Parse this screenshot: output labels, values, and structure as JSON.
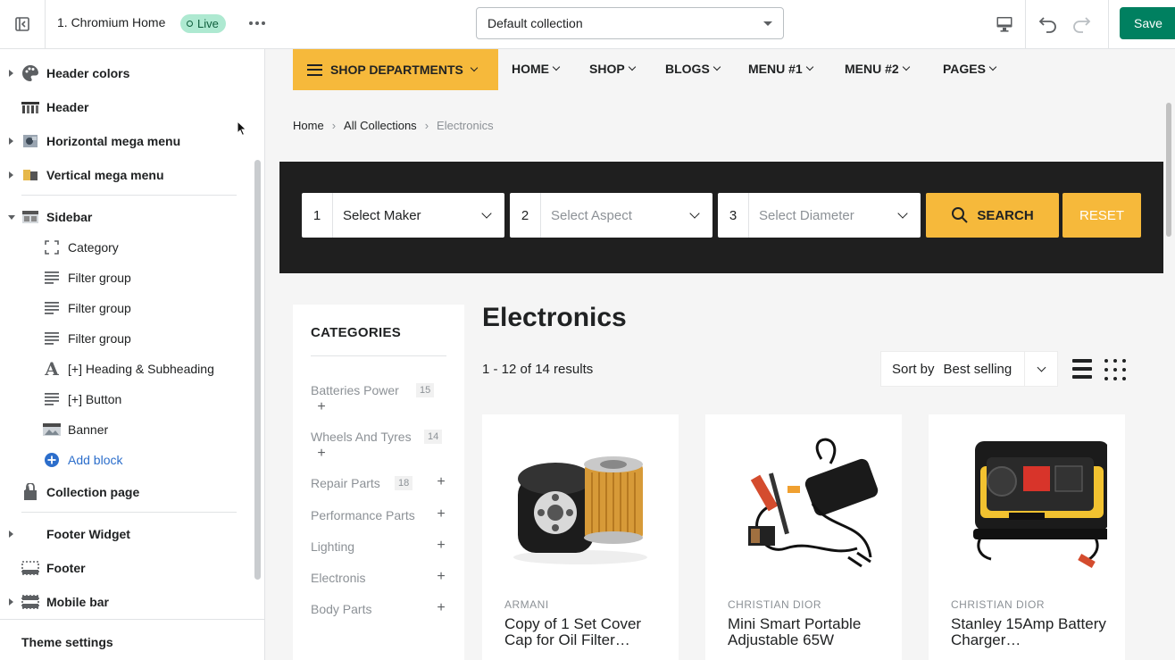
{
  "topbar": {
    "theme_title": "1. Chromium Home",
    "live_label": "Live",
    "collection_select": "Default collection",
    "save_label": "Save"
  },
  "sidebar": {
    "sections": [
      {
        "label": "Header colors",
        "icon": "palette-icon",
        "expandable": true
      },
      {
        "label": "Header",
        "icon": "header-thumb-icon",
        "expandable": false
      },
      {
        "label": "Horizontal mega menu",
        "icon": "mega-menu-thumb-icon",
        "expandable": true
      },
      {
        "label": "Vertical mega menu",
        "icon": "vertical-menu-thumb-icon",
        "expandable": true
      },
      {
        "label": "Sidebar",
        "icon": "sidebar-thumb-icon",
        "expandable": true,
        "expanded": true
      }
    ],
    "sidebar_blocks": [
      {
        "label": "Category",
        "icon": "crop-icon"
      },
      {
        "label": "Filter group",
        "icon": "lines-icon"
      },
      {
        "label": "Filter group",
        "icon": "lines-icon"
      },
      {
        "label": "Filter group",
        "icon": "lines-icon"
      },
      {
        "label": "[+] Heading & Subheading",
        "icon": "text-icon"
      },
      {
        "label": "[+] Button",
        "icon": "lines-icon"
      },
      {
        "label": "Banner",
        "icon": "image-thumb-icon"
      }
    ],
    "add_block": "Add block",
    "lower_sections": [
      {
        "label": "Collection page",
        "icon": "collection-icon",
        "expandable": false
      },
      {
        "label": "Footer Widget",
        "icon": "none",
        "expandable": true
      },
      {
        "label": "Footer",
        "icon": "footer-icon",
        "expandable": false
      },
      {
        "label": "Mobile bar",
        "icon": "mobile-bar-icon",
        "expandable": true
      }
    ],
    "theme_settings": "Theme settings"
  },
  "preview": {
    "nav": {
      "shop_departments": "SHOP DEPARTMENTS",
      "items": [
        "HOME",
        "SHOP",
        "BLOGS",
        "MENU #1",
        "MENU #2",
        "PAGES"
      ]
    },
    "breadcrumb": [
      "Home",
      "All Collections",
      "Electronics"
    ],
    "search": {
      "selects": [
        {
          "num": "1",
          "label": "Select Maker"
        },
        {
          "num": "2",
          "label": "Select Aspect"
        },
        {
          "num": "3",
          "label": "Select Diameter"
        }
      ],
      "search_label": "SEARCH",
      "reset_label": "RESET"
    },
    "categories": {
      "title": "CATEGORIES",
      "items": [
        {
          "label": "Batteries Power",
          "count": "15"
        },
        {
          "label": "Wheels And Tyres",
          "count": "14"
        },
        {
          "label": "Repair Parts",
          "count": "18"
        },
        {
          "label": "Performance Parts",
          "count": ""
        },
        {
          "label": "Lighting",
          "count": ""
        },
        {
          "label": "Electronis",
          "count": ""
        },
        {
          "label": "Body Parts",
          "count": ""
        }
      ]
    },
    "collection_title": "Electronics",
    "results": "1 - 12 of 14 results",
    "sort": {
      "label": "Sort by",
      "value": "Best selling"
    },
    "products": [
      {
        "vendor": "ARMANI",
        "title": "Copy of 1 Set Cover Cap for Oil Filter…"
      },
      {
        "vendor": "CHRISTIAN DIOR",
        "title": "Mini Smart Portable Adjustable 65W"
      },
      {
        "vendor": "CHRISTIAN DIOR",
        "title": "Stanley 15Amp Battery Charger…"
      }
    ]
  },
  "colors": {
    "accent_yellow": "#f6b93b",
    "save_green": "#008060",
    "dark_band": "#1f1f1f",
    "link_blue": "#2c6ecb"
  }
}
